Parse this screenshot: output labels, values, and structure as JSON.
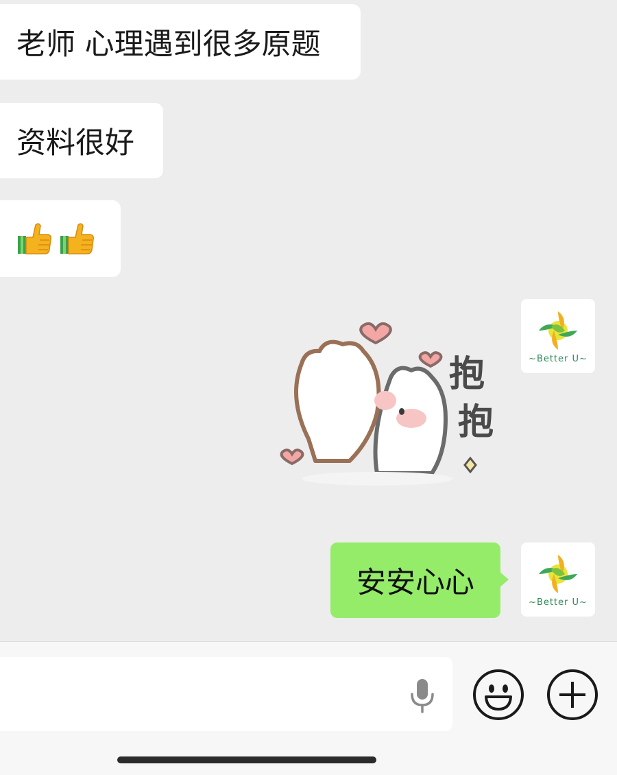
{
  "messages": {
    "m1": "老师 心理遇到很多原题",
    "m2": "资料很好",
    "m3_icons": [
      "thumbs-up-icon",
      "thumbs-up-icon"
    ],
    "sticker_text": [
      "抱",
      "抱"
    ],
    "sent_text": "安安心心"
  },
  "avatar": {
    "brand": "~Better U~"
  },
  "colors": {
    "chat_bg": "#ededed",
    "sent_bubble": "#95ec69",
    "received_bubble": "#ffffff"
  },
  "input_bar": {
    "icons": [
      "microphone-icon",
      "emoji-icon",
      "plus-icon"
    ]
  }
}
